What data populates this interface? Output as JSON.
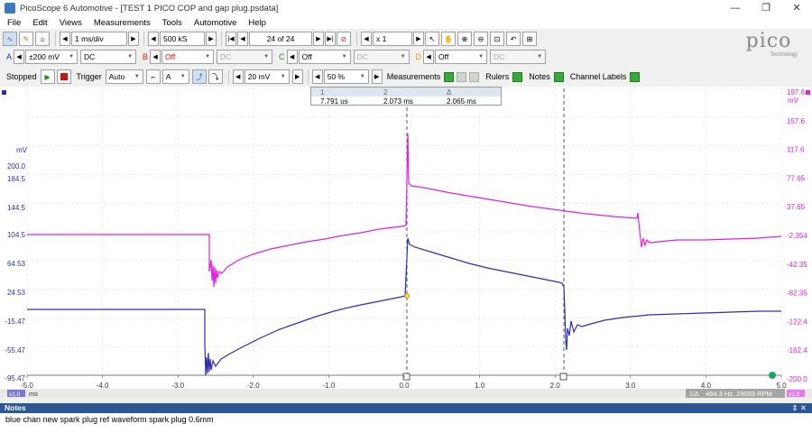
{
  "window": {
    "title": "PicoScope 6 Automotive - [TEST 1 PICO COP and gap plug.psdata]",
    "controls": [
      "—",
      "❐",
      "✕"
    ]
  },
  "menu": [
    "File",
    "Edit",
    "Views",
    "Measurements",
    "Tools",
    "Automotive",
    "Help"
  ],
  "toolbar1": {
    "timebase": "1 ms/div",
    "samples": "500 kS",
    "buffer": "24 of 24",
    "zoom": "x 1"
  },
  "channels": [
    {
      "letter": "A",
      "range": "±200 mV",
      "coupling": "DC",
      "enabled": true,
      "color": "#2d2db4"
    },
    {
      "letter": "B",
      "range": "Off",
      "coupling": "DC",
      "enabled": false,
      "color": "#e01010"
    },
    {
      "letter": "C",
      "range": "Off",
      "coupling": "DC",
      "enabled": false,
      "color": "#1a9a1a"
    },
    {
      "letter": "D",
      "range": "Off",
      "coupling": "DC",
      "enabled": false,
      "color": "#d2a000"
    }
  ],
  "toolbar3": {
    "state": "Stopped",
    "trigger_label": "Trigger",
    "trigger_mode": "Auto",
    "trigger_channel": "A",
    "trigger_level": "20 mV",
    "pretrigger": "50 %",
    "measurements": "Measurements",
    "rulers": "Rulers",
    "notes": "Notes",
    "channel_labels": "Channel Labels"
  },
  "logo": {
    "word": "pico",
    "sub": "Technology"
  },
  "ruler_box": {
    "headers": [
      "1",
      "2",
      "Δ"
    ],
    "values": [
      "7.791 us",
      "2.073 ms",
      "2.065 ms"
    ]
  },
  "axes": {
    "left_unit": "mV",
    "left_ticks": [
      "200.0",
      "184.5",
      "144.5",
      "104.5",
      "64.53",
      "24.53",
      "-15.47",
      "-55.47",
      "-95.47"
    ],
    "right_unit": "mV",
    "right_ticks": [
      "197.6",
      "157.6",
      "117.6",
      "77.65",
      "37.65",
      "-2.354",
      "-42.35",
      "-82.35",
      "-122.4",
      "-162.4",
      "-200.0"
    ],
    "x_ticks": [
      "-5.0",
      "-4.0",
      "-3.0",
      "-2.0",
      "-1.0",
      "0.0",
      "1.0",
      "2.0",
      "3.0",
      "4.0",
      "5.0"
    ],
    "x_unit": "ms",
    "x_badge": "x1.0",
    "right_badge": "x1.0",
    "freq_readout": "484.3 Hz, 29059 RPM",
    "freq_badge": "1/Δ"
  },
  "traces": {
    "blue_color": "#2d2db4",
    "magenta_color": "#e020e0"
  },
  "notes": {
    "title": "Notes",
    "buttons": "⇕  ✕",
    "text": "blue chan new spark plug ref waveform spark plug 0.6mm"
  }
}
